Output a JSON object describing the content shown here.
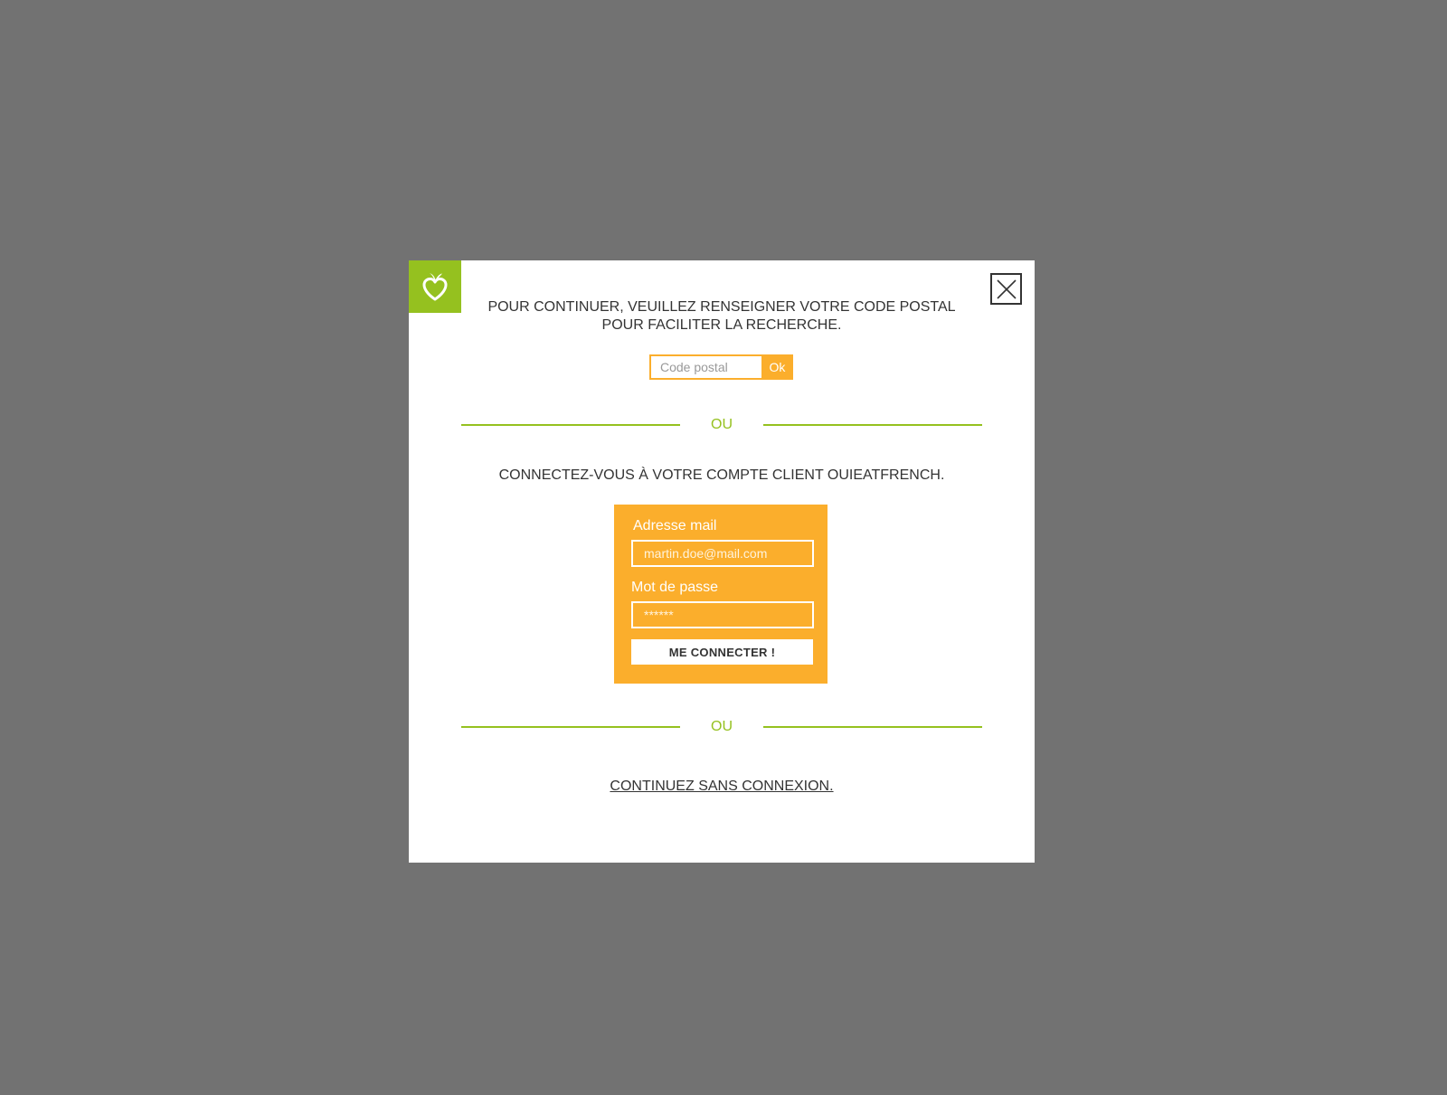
{
  "modal": {
    "intro_line1": "POUR CONTINUER, VEUILLEZ RENSEIGNER VOTRE CODE POSTAL",
    "intro_line2": "POUR FACILITER LA RECHERCHE.",
    "postal": {
      "placeholder": "Code postal",
      "value": "",
      "ok_label": "Ok"
    },
    "separator_label": "OU",
    "account_title": "CONNECTEZ-VOUS À VOTRE COMPTE CLIENT OUIEATFRENCH.",
    "login": {
      "email_label": "Adresse mail",
      "email_placeholder": "martin.doe@mail.com",
      "password_label": "Mot de passe",
      "password_placeholder": "******",
      "submit_label": "ME CONNECTER !"
    },
    "continue_label": "CONTINUEZ SANS CONNEXION.",
    "logo_icon": "heart-leaf-icon",
    "close_icon": "close-icon"
  },
  "colors": {
    "overlay": "#727272",
    "brand_green": "#95c11f",
    "brand_orange": "#fbae2c",
    "text": "#333333"
  }
}
